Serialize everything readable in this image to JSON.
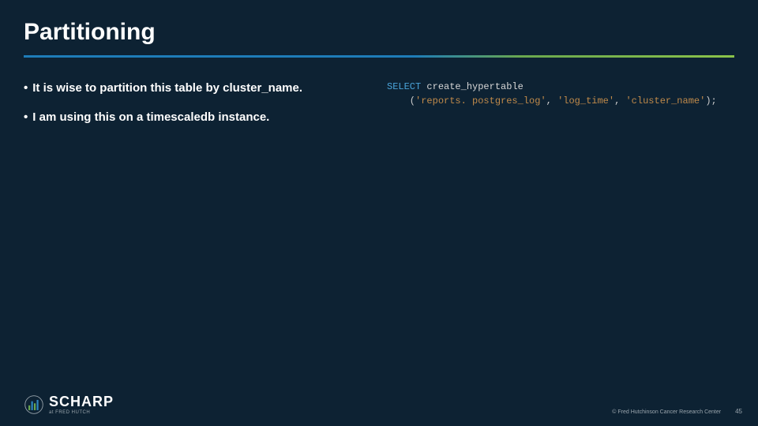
{
  "title": "Partitioning",
  "bullets": [
    "It is wise to partition this table by cluster_name.",
    "I am using this on a timescaledb instance."
  ],
  "code": {
    "keyword": "SELECT",
    "func": "create_hypertable",
    "args_indent": "    (",
    "arg1": "'reports. postgres_log'",
    "sep1": ", ",
    "arg2": "'log_time'",
    "sep2": ", ",
    "arg3": "'cluster_name'",
    "close": ");"
  },
  "logo": {
    "text": "SCHARP",
    "sub": "at FRED HUTCH"
  },
  "footer": {
    "copyright": "© Fred Hutchinson Cancer Research Center",
    "page": "45"
  }
}
